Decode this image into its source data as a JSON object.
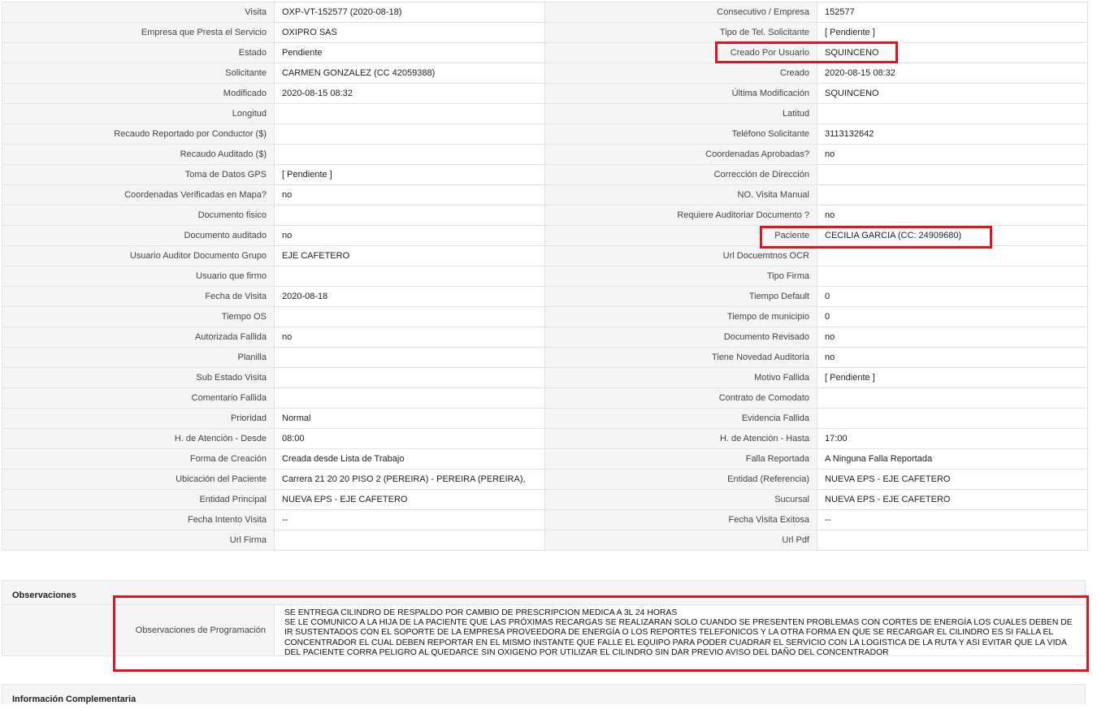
{
  "rows": [
    {
      "l1": "Visita",
      "v1": "OXP-VT-152577 (2020-08-18)",
      "l2": "Consecutivo / Empresa",
      "v2": "152577"
    },
    {
      "l1": "Empresa que Presta el Servicio",
      "v1": "OXIPRO SAS",
      "l2": "Tipo de Tel. Solicitante",
      "v2": "[ Pendiente ]"
    },
    {
      "l1": "Estado",
      "v1": "Pendiente",
      "l2": "Creado Por Usuario",
      "v2": "SQUINCENO"
    },
    {
      "l1": "Solicitante",
      "v1": "CARMEN GONZALEZ (CC 42059388)",
      "l2": "Creado",
      "v2": "2020-08-15 08:32"
    },
    {
      "l1": "Modificado",
      "v1": "2020-08-15 08:32",
      "l2": "Última Modificación",
      "v2": " SQUINCENO"
    },
    {
      "l1": "Longitud",
      "v1": "",
      "l2": "Latitud",
      "v2": ""
    },
    {
      "l1": "Recaudo Reportado por Conductor ($)",
      "v1": "",
      "l2": "Teléfono Solicitante",
      "v2": "3113132642"
    },
    {
      "l1": "Recaudo Auditado ($)",
      "v1": "",
      "l2": "Coordenadas Aprobadas?",
      "v2": " no"
    },
    {
      "l1": "Toma de Datos GPS",
      "v1": "[ Pendiente ]",
      "l2": "Corrección de Dirección",
      "v2": ""
    },
    {
      "l1": "Coordenadas Verificadas en Mapa?",
      "v1": " no",
      "l2": "NO. Visita Manual",
      "v2": ""
    },
    {
      "l1": "Documento fisico",
      "v1": "",
      "l2": "Requiere Auditoriar Documento ?",
      "v2": " no"
    },
    {
      "l1": "Documento auditado",
      "v1": " no",
      "l2": "Paciente",
      "v2": "CECILIA GARCIA (CC: 24909680)"
    },
    {
      "l1": "Usuario Auditor Documento Grupo",
      "v1": "EJE CAFETERO",
      "l2": "Url Docuemtnos OCR",
      "v2": ""
    },
    {
      "l1": "Usuario que firmo",
      "v1": "",
      "l2": "Tipo Firma",
      "v2": ""
    },
    {
      "l1": "Fecha de Visita",
      "v1": " 2020-08-18",
      "l2": "Tiempo Default",
      "v2": "0"
    },
    {
      "l1": "Tiempo OS",
      "v1": "",
      "l2": "Tiempo de municipio",
      "v2": "0"
    },
    {
      "l1": "Autorizada Fallida",
      "v1": " no",
      "l2": "Documento Revisado",
      "v2": " no"
    },
    {
      "l1": "Planilla",
      "v1": "",
      "l2": "Tiene Novedad Auditoria",
      "v2": " no"
    },
    {
      "l1": "Sub Estado Visita",
      "v1": "",
      "l2": "Motivo Fallida",
      "v2": "[ Pendiente ]"
    },
    {
      "l1": "Comentario Fallida",
      "v1": "",
      "l2": "Contrato de Comodato",
      "v2": ""
    },
    {
      "l1": "Prioridad",
      "v1": "Normal",
      "l2": "Evidencia Fallida",
      "v2": ""
    },
    {
      "l1": "H. de Atención - Desde",
      "v1": "08:00",
      "l2": "H. de Atención - Hasta",
      "v2": "17:00"
    },
    {
      "l1": "Forma de Creación",
      "v1": "Creada desde Lista de Trabajo",
      "l2": "Falla Reportada",
      "v2": "A Ninguna Falla Reportada"
    },
    {
      "l1": "Ubicación del Paciente",
      "v1": "Carrera 21 20 20 PISO 2 (PEREIRA) - PEREIRA (PEREIRA),",
      "l2": "Entidad (Referencia)",
      "v2": "NUEVA EPS - EJE CAFETERO"
    },
    {
      "l1": "Entidad Principal",
      "v1": "NUEVA EPS - EJE CAFETERO",
      "l2": "Sucursal",
      "v2": "NUEVA EPS - EJE CAFETERO"
    },
    {
      "l1": "Fecha Intento Visita",
      "v1": " --",
      "l2": "Fecha Visita Exitosa",
      "v2": " --"
    },
    {
      "l1": "Url Firma",
      "v1": "",
      "l2": "Url Pdf",
      "v2": ""
    }
  ],
  "observaciones": {
    "title": "Observaciones",
    "label": "Observaciones de Programación",
    "text": " SE ENTREGA CILINDRO DE RESPALDO POR CAMBIO DE PRESCRIPCION MEDICA A 3L 24 HORAS\n SE LE COMUNICO A LA HIJA DE LA PACIENTE QUE LAS PRÓXIMAS RECARGAS SE REALIZARAN SOLO CUANDO SE PRESENTEN PROBLEMAS CON CORTES DE ENERGÍA LOS CUALES DEBEN DE IR SUSTENTADOS CON EL SOPORTE DE LA EMPRESA PROVEEDORA DE ENERGÍA O LOS REPORTES TELEFONICOS Y LA OTRA FORMA EN QUE SE RECARGAR EL CILINDRO ES SI FALLA EL CONCENTRADOR EL CUAL DEBEN REPORTAR EN EL MISMO INSTANTE QUE FALLE EL EQUIPO PARA PODER CUADRAR EL SERVICIO CON LA LOGISTICA DE LA RUTA Y ASI EVITAR QUE LA VIDA DEL PACIENTE CORRA PELIGRO AL QUEDARCE SIN OXIGENO POR UTILIZAR EL CILINDRO SIN DAR PREVIO AVISO DEL DAÑO DEL CONCENTRADOR"
  },
  "complementaria": {
    "title": "Información Complementaria"
  },
  "colors": {
    "highlight": "#e0141e",
    "label_bg": "#f5f5f5",
    "border": "#e3e3e3"
  }
}
